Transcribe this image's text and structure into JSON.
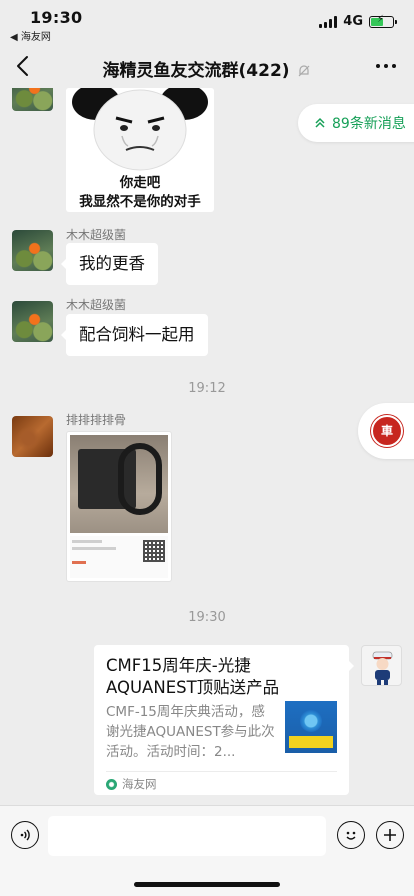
{
  "status_bar": {
    "time": "19:30",
    "back_app": "◀ 海友网",
    "network": "4G",
    "battery_level": 0.55
  },
  "nav": {
    "title": "海精灵鱼友交流群(422)",
    "muted": true
  },
  "new_messages_pill": "89条新消息",
  "messages": [
    {
      "type": "sticker",
      "caption_line1": "你走吧",
      "caption_line2": "我显然不是你的对手"
    },
    {
      "type": "text",
      "sender": "木木超级菌",
      "text": "我的更香"
    },
    {
      "type": "text",
      "sender": "木木超级菌",
      "text": "配合饲料一起用"
    },
    {
      "type": "timestamp",
      "text": "19:12"
    },
    {
      "type": "image",
      "sender": "排排排排骨"
    },
    {
      "type": "timestamp",
      "text": "19:30"
    },
    {
      "type": "link_card",
      "title": "CMF15周年庆-光捷AQUANEST顶贴送产品",
      "description": "CMF-15周年庆典活动，感谢光捷AQUANEST参与此次活动。活动时间：2...",
      "source": "海友网"
    }
  ],
  "colors": {
    "background": "#ededed",
    "bubble": "#ffffff",
    "accent_green": "#17a058",
    "sender_gray": "#777777"
  },
  "icons": {
    "nav_back": "chevron-left-icon",
    "nav_mute": "bell-slash-icon",
    "nav_more": "more-dots-icon",
    "voice": "voice-icon",
    "emoji": "emoji-icon",
    "plus": "plus-icon"
  }
}
